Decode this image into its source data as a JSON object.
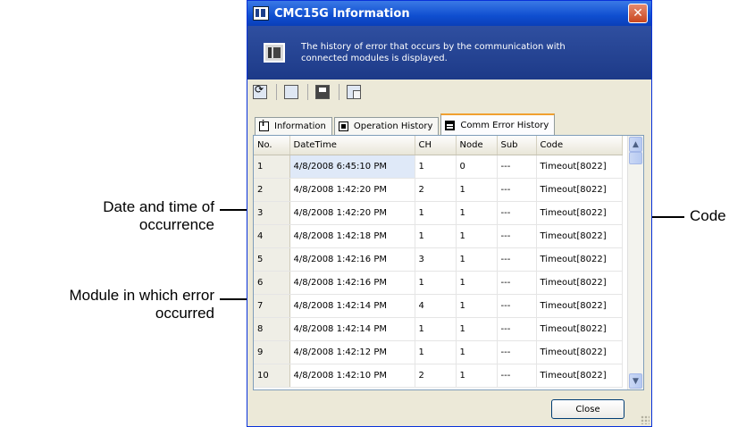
{
  "window": {
    "title": "CMC15G Information",
    "banner_text": "The history of error that occurs by the communication with connected modules is displayed."
  },
  "toolbar": {
    "buttons": [
      "refresh-icon",
      "print-icon",
      "save-icon",
      "copy-icon"
    ]
  },
  "tabs": [
    {
      "label": "Information",
      "icon": "info-icon"
    },
    {
      "label": "Operation History",
      "icon": "operation-icon"
    },
    {
      "label": "Comm Error History",
      "icon": "comm-error-icon",
      "active": true
    }
  ],
  "table": {
    "headers": [
      "No.",
      "DateTime",
      "CH",
      "Node",
      "Sub",
      "Code"
    ],
    "rows": [
      [
        "1",
        "4/8/2008 6:45:10 PM",
        "1",
        "0",
        "---",
        "Timeout[8022]"
      ],
      [
        "2",
        "4/8/2008 1:42:20 PM",
        "2",
        "1",
        "---",
        "Timeout[8022]"
      ],
      [
        "3",
        "4/8/2008 1:42:20 PM",
        "1",
        "1",
        "---",
        "Timeout[8022]"
      ],
      [
        "4",
        "4/8/2008 1:42:18 PM",
        "1",
        "1",
        "---",
        "Timeout[8022]"
      ],
      [
        "5",
        "4/8/2008 1:42:16 PM",
        "3",
        "1",
        "---",
        "Timeout[8022]"
      ],
      [
        "6",
        "4/8/2008 1:42:16 PM",
        "1",
        "1",
        "---",
        "Timeout[8022]"
      ],
      [
        "7",
        "4/8/2008 1:42:14 PM",
        "4",
        "1",
        "---",
        "Timeout[8022]"
      ],
      [
        "8",
        "4/8/2008 1:42:14 PM",
        "1",
        "1",
        "---",
        "Timeout[8022]"
      ],
      [
        "9",
        "4/8/2008 1:42:12 PM",
        "1",
        "1",
        "---",
        "Timeout[8022]"
      ],
      [
        "10",
        "4/8/2008 1:42:10 PM",
        "2",
        "1",
        "---",
        "Timeout[8022]"
      ]
    ]
  },
  "buttons": {
    "close_label": "Close"
  },
  "annotations": {
    "datetime_line1": "Date and time of",
    "datetime_line2": "occurrence",
    "module_line1": "Module in which error",
    "module_line2": "occurred",
    "code": "Code"
  }
}
